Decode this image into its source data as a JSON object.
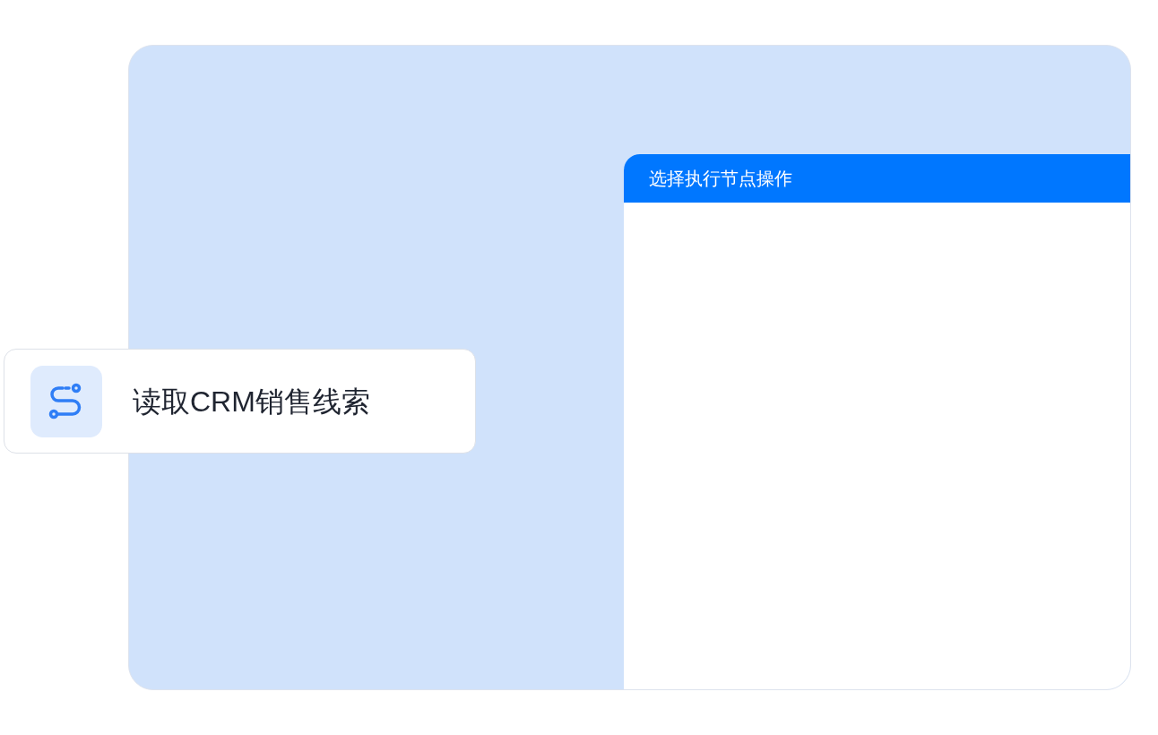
{
  "panel": {
    "title": "选择执行节点操作"
  },
  "node": {
    "label": "读取CRM销售线索"
  }
}
